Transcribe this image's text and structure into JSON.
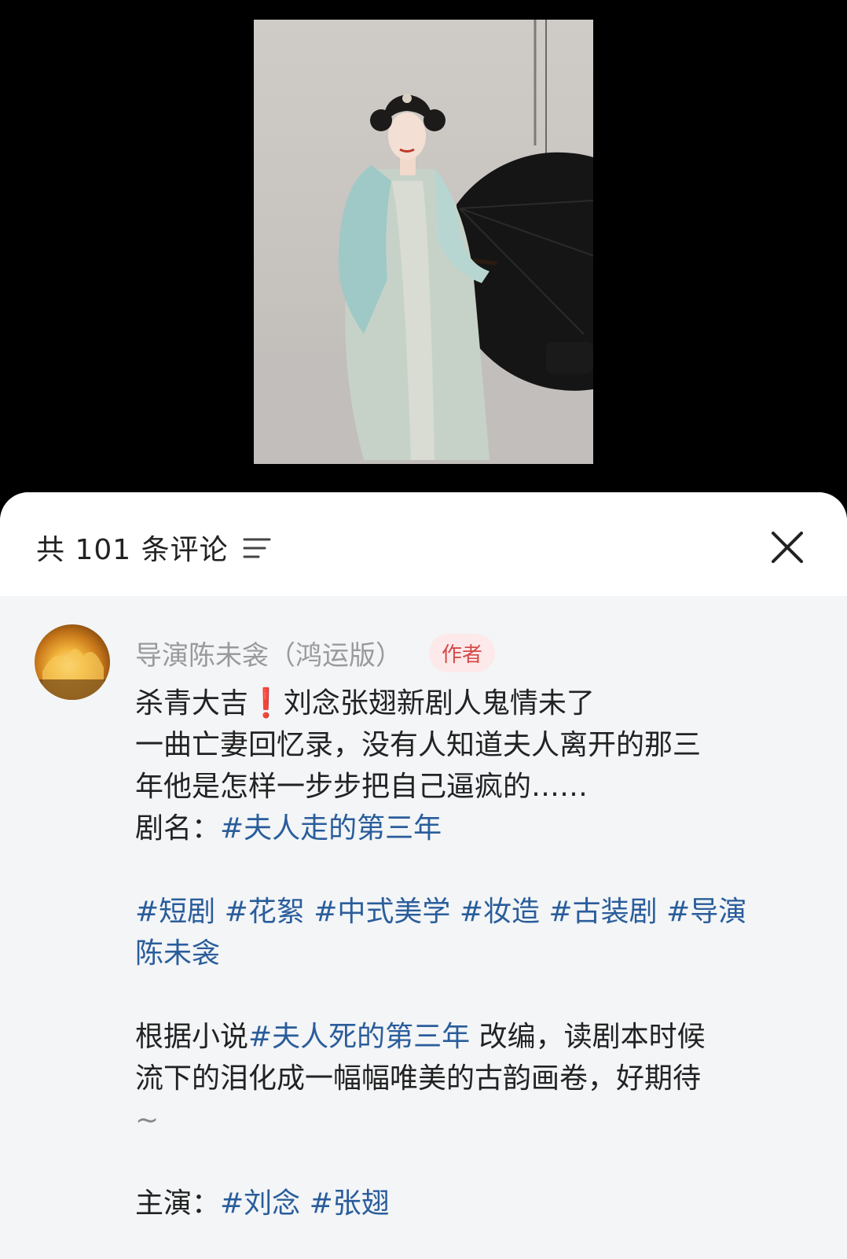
{
  "header": {
    "comment_count_title": "共 101 条评论"
  },
  "icons": {
    "sort": "sort-filter-icon",
    "close": "close-icon"
  },
  "comment": {
    "author": "导演陈未衾（鸿运版）",
    "badge": "作者",
    "line1_text": "杀青大吉",
    "line1_emoji": "❗",
    "line1_rest": "刘念张翅新剧人鬼情未了",
    "line2": "一曲亡妻回忆录，没有人知道夫人离开的那三",
    "line3": "年他是怎样一步步把自己逼疯的……",
    "drama_prefix": "剧名：",
    "drama_tag": "#夫人走的第三年",
    "tags_line1": "#短剧 #花絮 #中式美学 #妆造 #古装剧 #导演",
    "tags_line2": "陈未衾",
    "novel_prefix": "根据小说",
    "novel_tag": "#夫人死的第三年",
    "novel_rest": " 改编，读剧本时候",
    "novel_line2": "流下的泪化成一幅幅唯美的古韵画卷，好期待",
    "novel_line3": "~",
    "cast_prefix": "主演：",
    "cast_tags": "#刘念 #张翅"
  },
  "colors": {
    "background_top": "#000000",
    "sheet_bg": "#f3f5f7",
    "header_bg": "#ffffff",
    "hashtag": "#2a5d9b",
    "author_name": "#9a9a9a",
    "badge_text": "#d44a4a",
    "badge_bg": "#fde9e9"
  }
}
